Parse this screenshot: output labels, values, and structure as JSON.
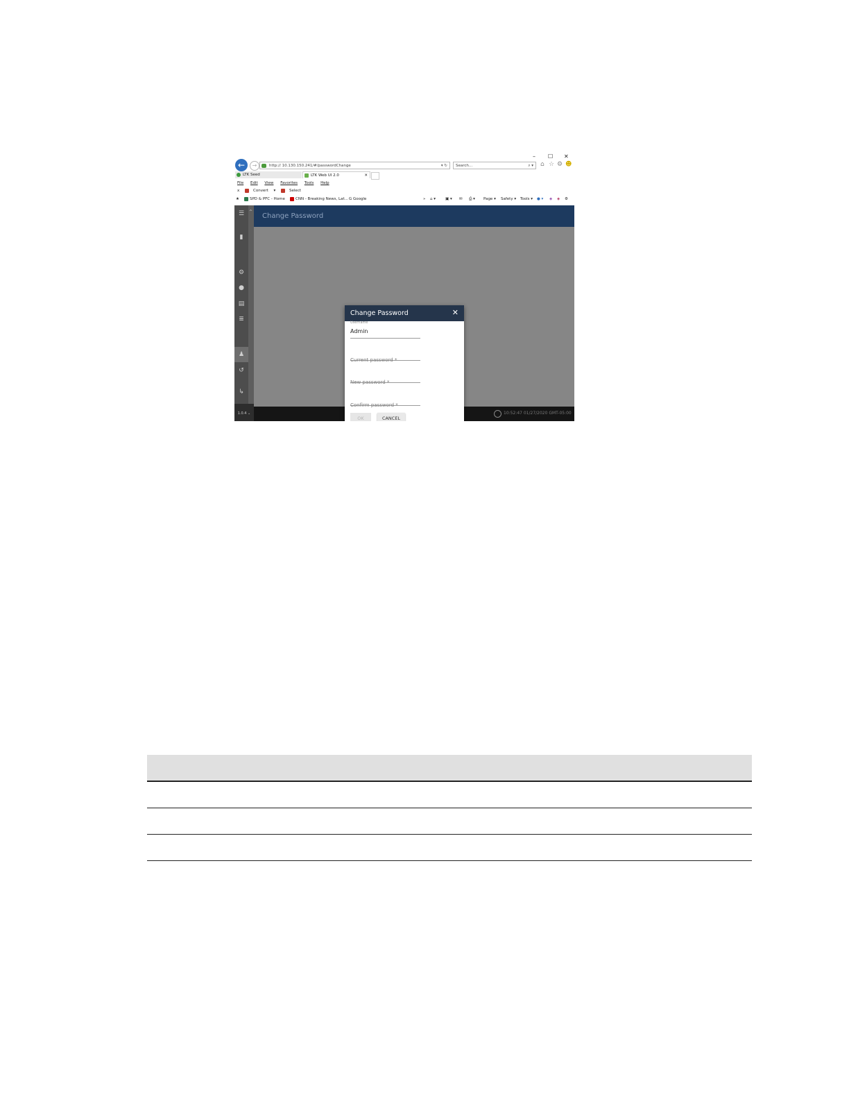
{
  "browser": {
    "window_controls": [
      "–",
      "☐",
      "✕"
    ],
    "address": "http:// 10.130.150.241/#/passwordChange",
    "search_placeholder": "Search...",
    "tabs": [
      {
        "label": "LTK Seed"
      },
      {
        "label": "LTK Web UI 2.0"
      }
    ],
    "menu": [
      "File",
      "Edit",
      "View",
      "Favorites",
      "Tools",
      "Help"
    ],
    "convert_label": "Convert",
    "select_label": "Select",
    "favorites": [
      "SPD & PFC - Home",
      "CNN - Breaking News, Lat...",
      "Google"
    ],
    "commands": [
      "Page",
      "Safety",
      "Tools"
    ]
  },
  "app": {
    "header_title": "Change Password",
    "nav_bottom_label": "1.0.4",
    "footer_timestamp": "10:52:47 01/27/2020 GMT-05:00"
  },
  "dialog": {
    "title": "Change Password",
    "username_label": "Username",
    "username_value": "Admin",
    "current_password_label": "Current password *",
    "new_password_label": "New password *",
    "confirm_password_label": "Confirm password *",
    "ok_label": "OK",
    "cancel_label": "CANCEL"
  },
  "table": {
    "header": [
      ""
    ],
    "rows": [
      "",
      "",
      ""
    ]
  },
  "colors": {
    "app_header": "#1d3a5f",
    "dialog_header": "#25354b",
    "overlay": "#858585"
  }
}
